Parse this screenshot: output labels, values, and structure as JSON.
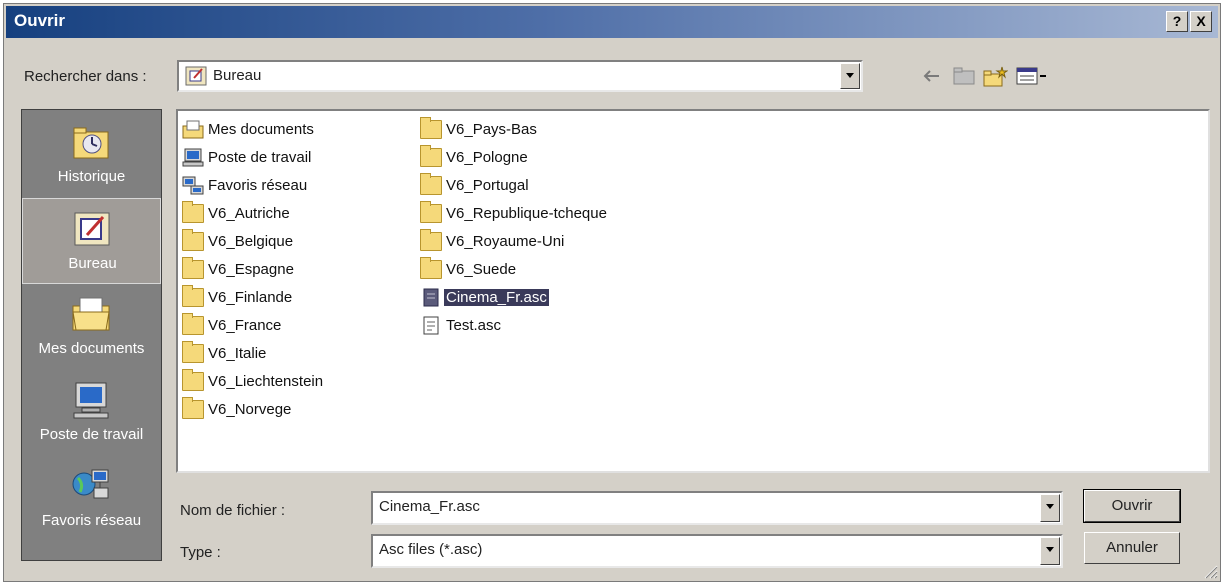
{
  "window": {
    "title": "Ouvrir",
    "help_btn": "?",
    "close_btn": "X"
  },
  "lookin": {
    "label": "Rechercher dans :",
    "value": "Bureau"
  },
  "places": [
    {
      "label": "Historique",
      "icon": "history-icon"
    },
    {
      "label": "Bureau",
      "icon": "desktop-icon",
      "active": true
    },
    {
      "label": "Mes documents",
      "icon": "my-documents-icon"
    },
    {
      "label": "Poste de travail",
      "icon": "my-computer-icon"
    },
    {
      "label": "Favoris réseau",
      "icon": "network-places-icon"
    }
  ],
  "files": {
    "col1": [
      {
        "name": "Mes documents",
        "icon": "my-documents-icon"
      },
      {
        "name": "Poste de travail",
        "icon": "my-computer-icon"
      },
      {
        "name": "Favoris réseau",
        "icon": "network-places-icon"
      },
      {
        "name": "V6_Autriche",
        "icon": "folder-icon"
      },
      {
        "name": "V6_Belgique",
        "icon": "folder-icon"
      },
      {
        "name": "V6_Espagne",
        "icon": "folder-icon"
      },
      {
        "name": "V6_Finlande",
        "icon": "folder-icon"
      },
      {
        "name": "V6_France",
        "icon": "folder-icon"
      },
      {
        "name": "V6_Italie",
        "icon": "folder-icon"
      },
      {
        "name": "V6_Liechtenstein",
        "icon": "folder-icon"
      },
      {
        "name": "V6_Norvege",
        "icon": "folder-icon"
      }
    ],
    "col2": [
      {
        "name": "V6_Pays-Bas",
        "icon": "folder-icon"
      },
      {
        "name": "V6_Pologne",
        "icon": "folder-icon"
      },
      {
        "name": "V6_Portugal",
        "icon": "folder-icon"
      },
      {
        "name": "V6_Republique-tcheque",
        "icon": "folder-icon"
      },
      {
        "name": "V6_Royaume-Uni",
        "icon": "folder-icon"
      },
      {
        "name": "V6_Suede",
        "icon": "folder-icon"
      },
      {
        "name": "Cinema_Fr.asc",
        "icon": "file-icon",
        "selected": true
      },
      {
        "name": "Test.asc",
        "icon": "file-icon"
      }
    ]
  },
  "filename": {
    "label": "Nom de fichier :",
    "value": "Cinema_Fr.asc"
  },
  "filetype": {
    "label": "Type :",
    "value": "Asc files (*.asc)"
  },
  "buttons": {
    "open": "Ouvrir",
    "cancel": "Annuler"
  },
  "colors": {
    "title_start": "#16407f",
    "selection": "#3a3a5a",
    "folder": "#f5d97a"
  }
}
